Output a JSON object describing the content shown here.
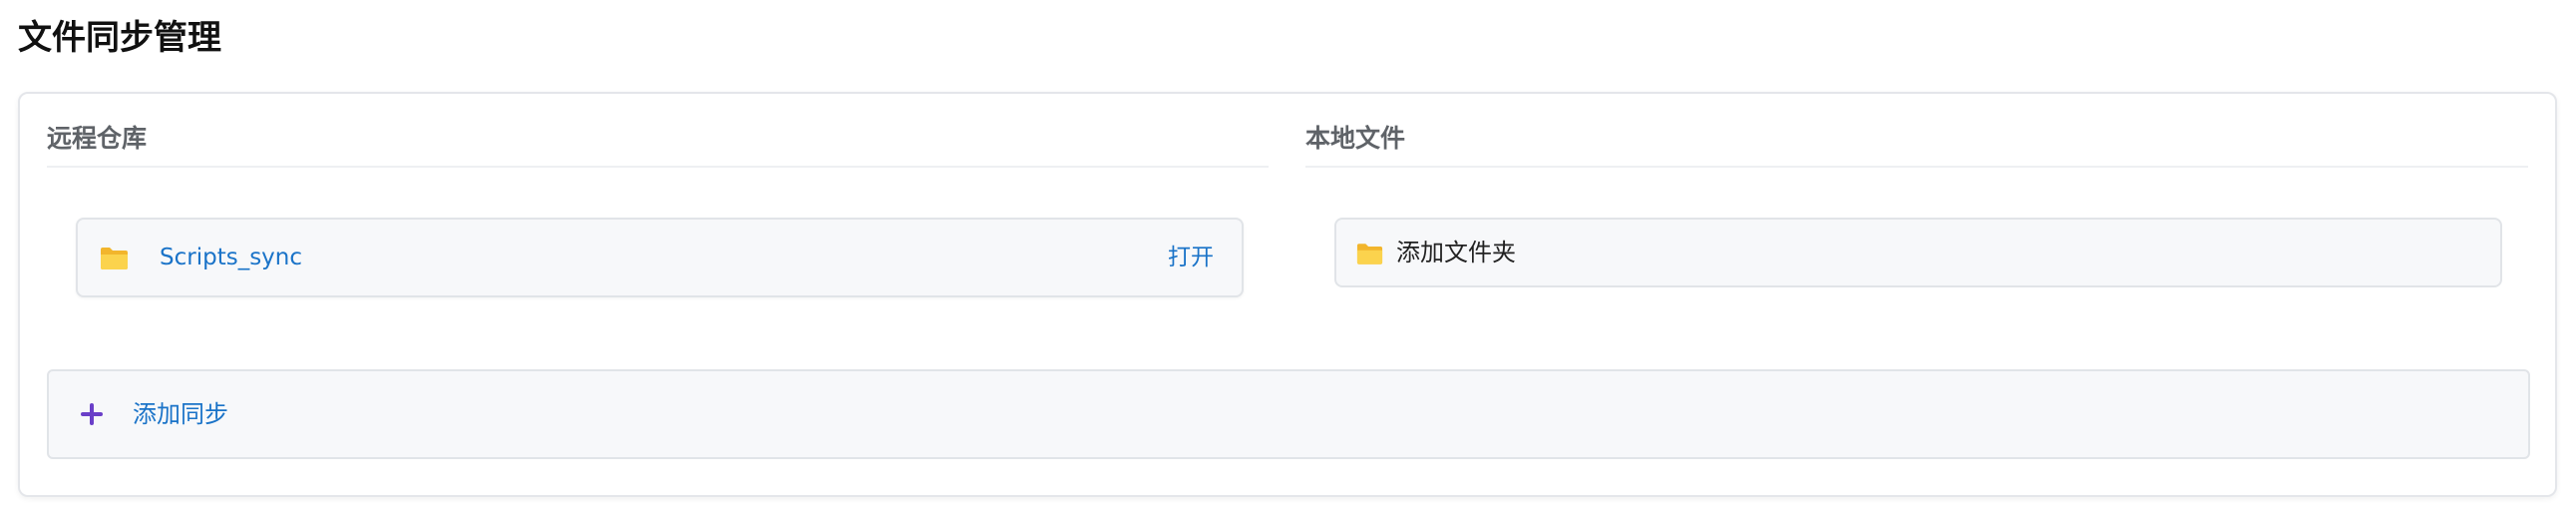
{
  "page": {
    "title": "文件同步管理"
  },
  "remote": {
    "heading": "远程仓库",
    "repos": [
      {
        "name": "Scripts_sync",
        "open_label": "打开",
        "icon": "folder-icon"
      }
    ]
  },
  "local": {
    "heading": "本地文件",
    "add_folder_label": "添加文件夹",
    "icon": "folder-icon"
  },
  "actions": {
    "add_sync_label": "添加同步",
    "add_sync_icon": "plus-icon"
  },
  "colors": {
    "link": "#1a73c8",
    "folder": "#f6c344",
    "plus": "#6a3fc8",
    "heading": "#5f6368"
  }
}
